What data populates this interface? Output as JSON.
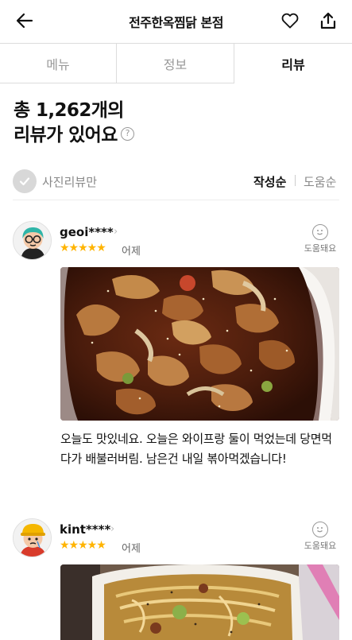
{
  "header": {
    "title": "전주한옥찜닭 본점",
    "back_icon": "arrow-left-icon",
    "like_icon": "heart-icon",
    "share_icon": "share-icon"
  },
  "tabs": [
    {
      "label": "메뉴",
      "active": false
    },
    {
      "label": "정보",
      "active": false
    },
    {
      "label": "리뷰",
      "active": true
    }
  ],
  "summary": {
    "line1": "총 1,262개의",
    "line2": "리뷰가 있어요",
    "help_icon": "?"
  },
  "filter": {
    "photo_only_label": "사진리뷰만",
    "sort_options": [
      "작성순",
      "도움순"
    ],
    "active_sort": "작성순"
  },
  "reviews": [
    {
      "nickname": "geoi****",
      "stars": "★★★★★",
      "rating": 5,
      "date": "어제",
      "helpful_label": "도움돼요",
      "text": "오늘도 맛있네요. 오늘은 와이프랑 둘이 먹었는데 당면먹다가 배불러버림. 남은건 내일 볶아먹겠습니다!"
    },
    {
      "nickname": "kint****",
      "stars": "★★★★★",
      "rating": 5,
      "date": "어제",
      "helpful_label": "도움돼요",
      "text": ""
    }
  ],
  "colors": {
    "star": "#ffb400",
    "text_primary": "#111111",
    "text_muted": "#888888",
    "divider": "#dcdcdc"
  }
}
